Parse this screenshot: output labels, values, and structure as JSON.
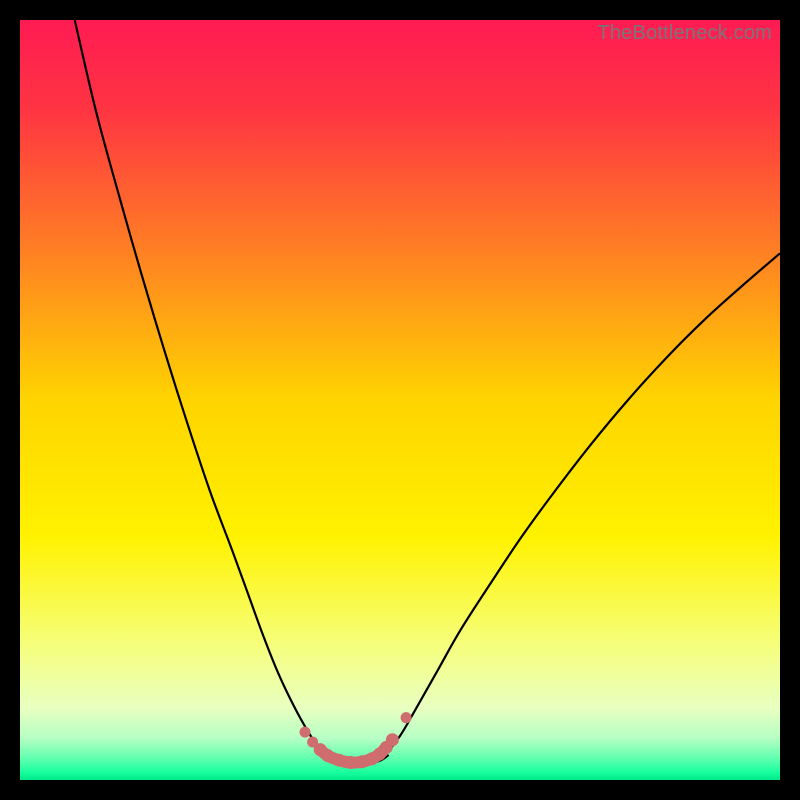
{
  "watermark": "TheBottleneck.com",
  "chart_data": {
    "type": "line",
    "title": "",
    "xlabel": "",
    "ylabel": "",
    "xlim": [
      0,
      100
    ],
    "ylim": [
      0,
      100
    ],
    "grid": false,
    "legend": false,
    "background_gradient": {
      "type": "vertical",
      "stops": [
        {
          "pos": 0.0,
          "color": "#ff1b53"
        },
        {
          "pos": 0.12,
          "color": "#ff3542"
        },
        {
          "pos": 0.3,
          "color": "#ff7e24"
        },
        {
          "pos": 0.5,
          "color": "#ffd400"
        },
        {
          "pos": 0.68,
          "color": "#fff200"
        },
        {
          "pos": 0.82,
          "color": "#f6ff7a"
        },
        {
          "pos": 0.905,
          "color": "#e8ffc0"
        },
        {
          "pos": 0.945,
          "color": "#b6ffc4"
        },
        {
          "pos": 0.97,
          "color": "#66ffb0"
        },
        {
          "pos": 0.99,
          "color": "#18ff9e"
        },
        {
          "pos": 1.0,
          "color": "#00e887"
        }
      ]
    },
    "series": [
      {
        "name": "left-curve",
        "x": [
          7.2,
          10,
          13,
          16,
          19,
          22,
          25,
          28,
          30,
          32,
          34,
          36,
          38,
          40
        ],
        "values": [
          100,
          88,
          77,
          66.5,
          56.5,
          47,
          38,
          30,
          24.5,
          19,
          14,
          9.8,
          6.2,
          3.2
        ]
      },
      {
        "name": "right-curve",
        "x": [
          48,
          50,
          52,
          55,
          58,
          62,
          66,
          70,
          75,
          80,
          85,
          90,
          95,
          100
        ],
        "values": [
          3.2,
          5.8,
          9.2,
          14.5,
          19.8,
          26,
          32,
          37.5,
          44,
          50,
          55.5,
          60.5,
          65,
          69.3
        ]
      },
      {
        "name": "valley-floor",
        "x": [
          40,
          41.5,
          43,
          44.5,
          46,
          47.5,
          48.5
        ],
        "values": [
          3.2,
          2.4,
          2.1,
          2.05,
          2.15,
          2.6,
          3.3
        ]
      }
    ],
    "annotations": [
      {
        "name": "valley-dot-sequence",
        "type": "markers",
        "color": "#cf6d6e",
        "x": [
          37.5,
          38.5,
          39.5,
          40.5,
          42,
          43.5,
          45,
          46.3,
          47.3,
          48.2,
          49.0,
          50.8
        ],
        "values": [
          6.3,
          5.0,
          4.0,
          3.2,
          2.6,
          2.3,
          2.4,
          2.8,
          3.4,
          4.3,
          5.3,
          8.2
        ]
      }
    ]
  }
}
